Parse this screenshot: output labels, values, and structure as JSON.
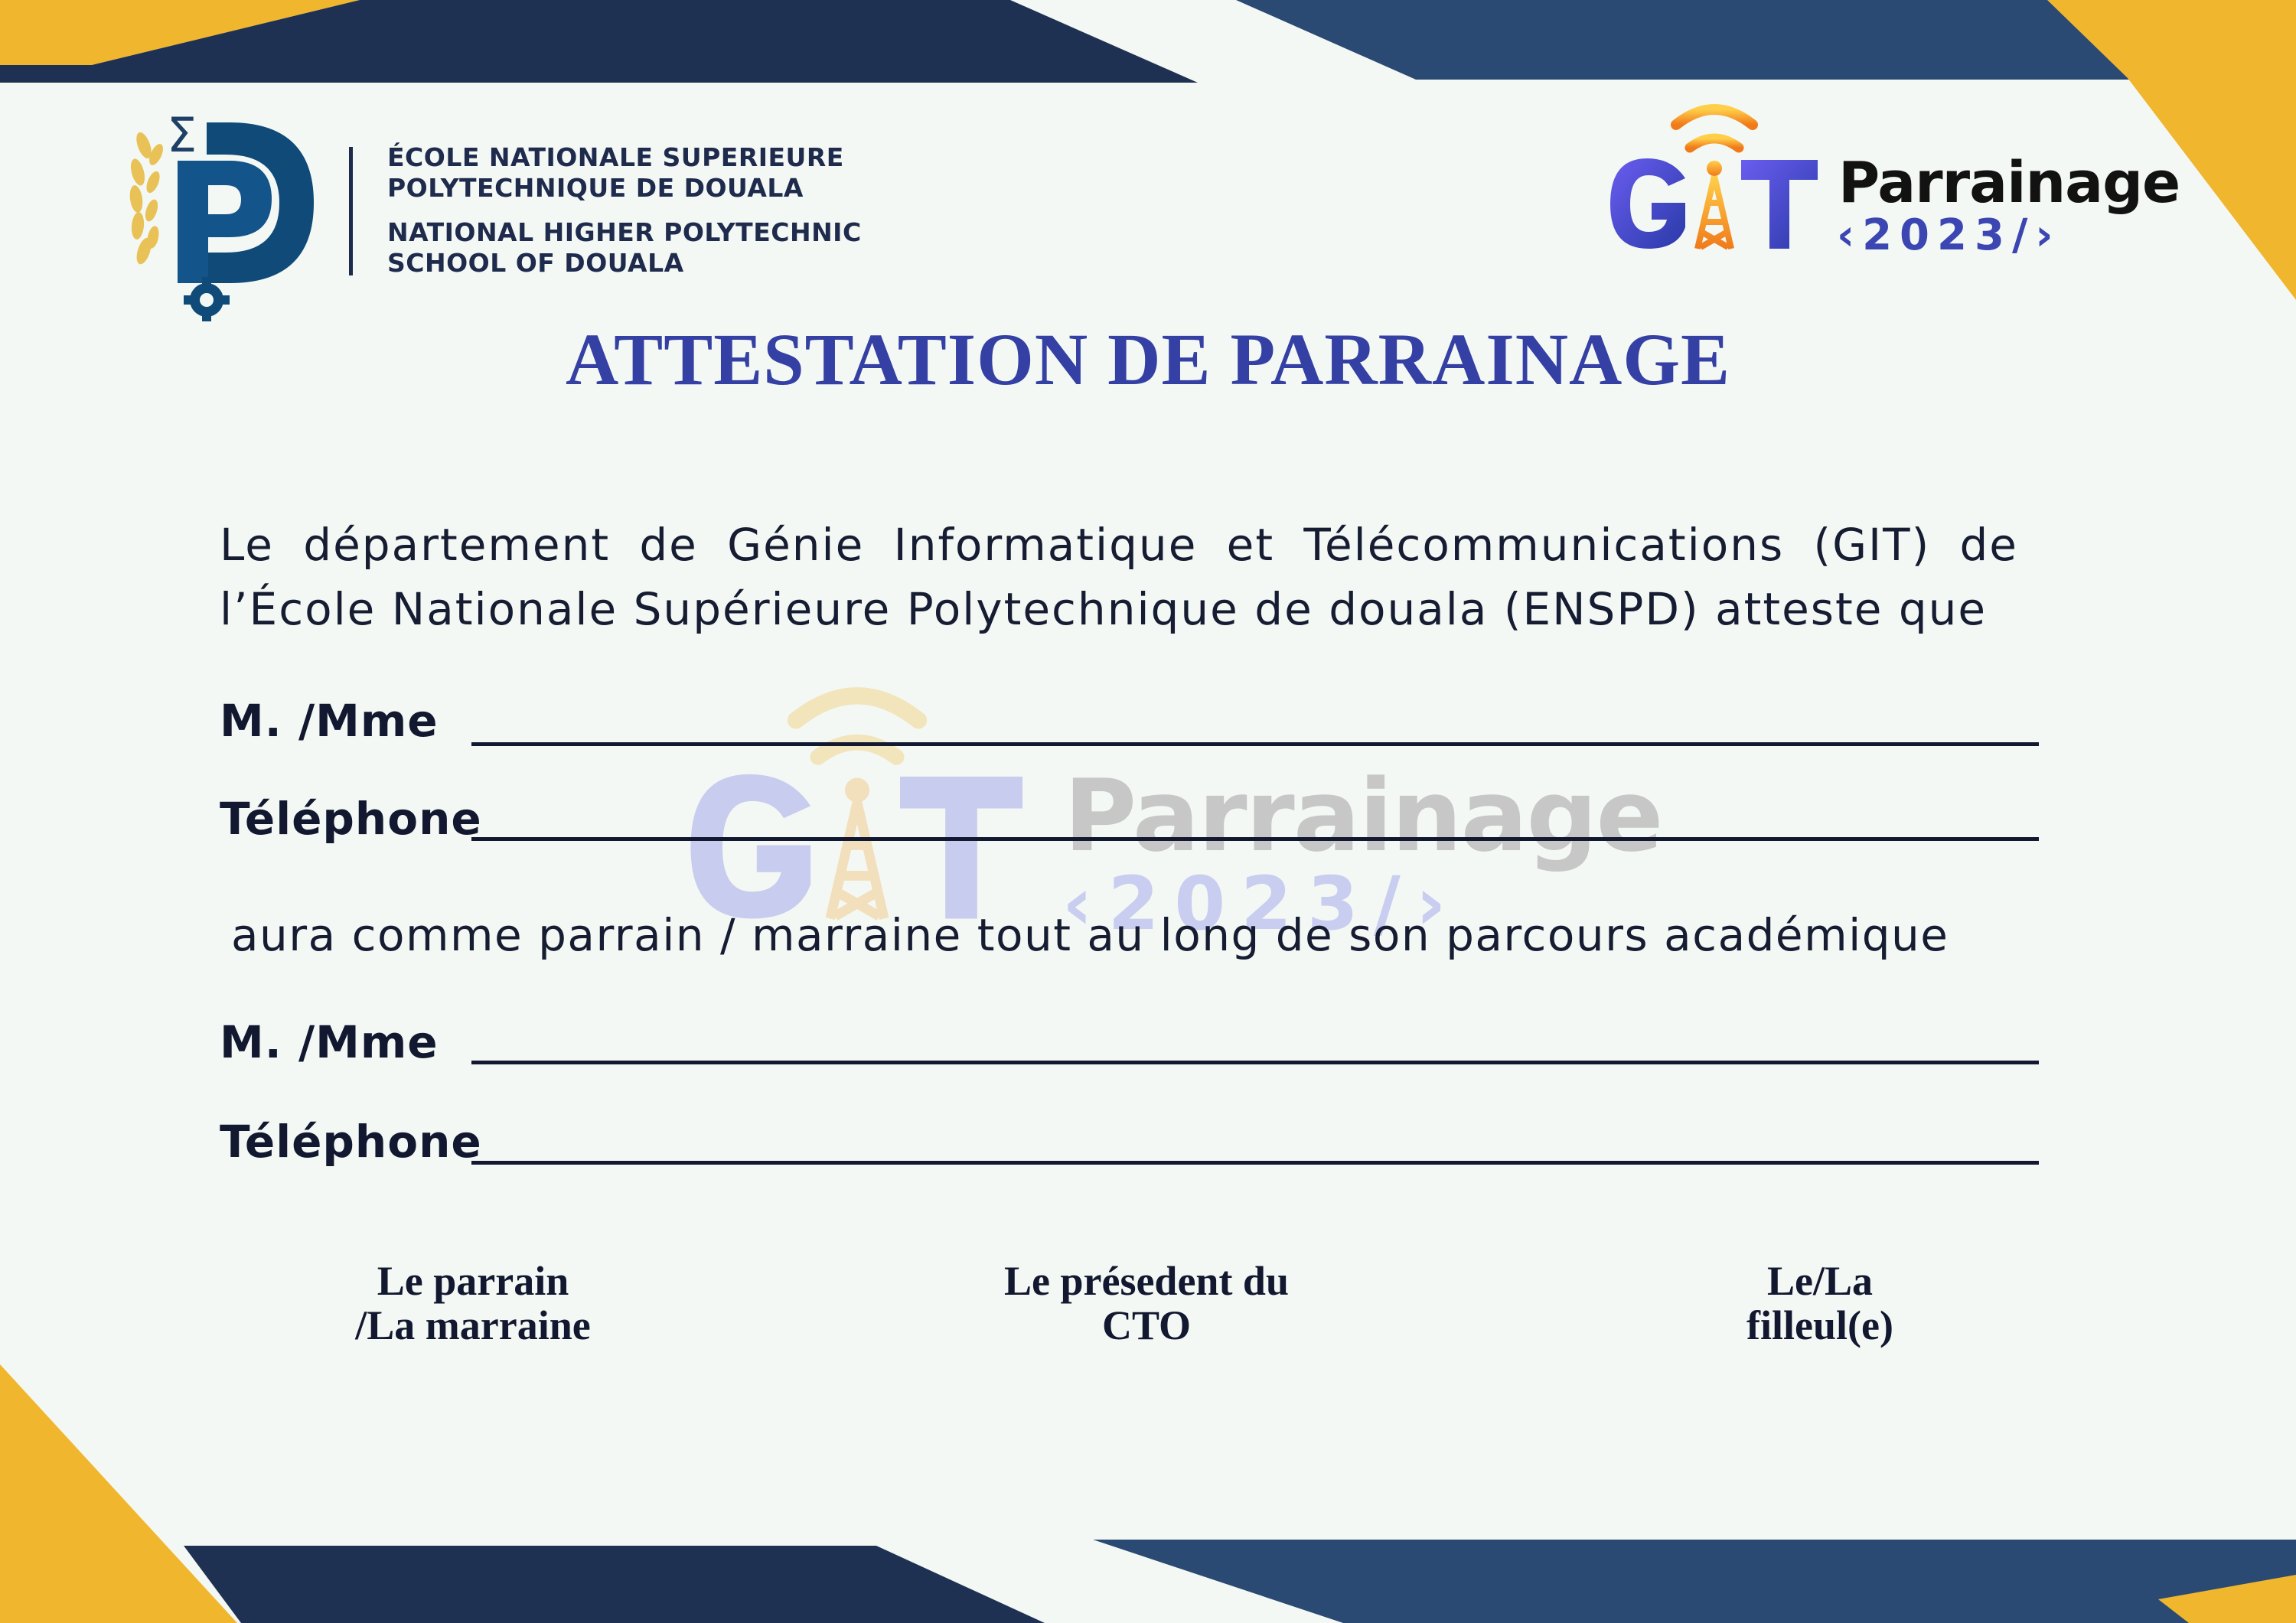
{
  "header": {
    "school_fr_line1": "ÉCOLE NATIONALE SUPERIEURE",
    "school_fr_line2": "POLYTECHNIQUE DE DOUALA",
    "school_en_line1": "NATIONAL HIGHER POLYTECHNIC",
    "school_en_line2": "SCHOOL OF DOUALA",
    "school_logo_icon": "enspd-logo-icon",
    "event_logo": {
      "letters": "GIT",
      "word": "Parrainage",
      "year": "‹2023/›",
      "icon": "radio-tower-icon"
    }
  },
  "title": "ATTESTATION DE PARRAINAGE",
  "intro": {
    "line1": "Le département de Génie Informatique et Télécommunications (GIT) de",
    "line2": "l’École Nationale Supérieure Polytechnique de douala (ENSPD) atteste que"
  },
  "filleul": {
    "name_label": "M. /Mme",
    "phone_label": "Téléphone"
  },
  "middle_text": "aura comme parrain / marraine tout au long de son parcours académique",
  "parrain": {
    "name_label": "M. /Mme",
    "phone_label": "Téléphone"
  },
  "signatures": [
    {
      "line1": "Le parrain",
      "line2": "/La marraine"
    },
    {
      "line1": "Le présedent du",
      "line2": "CTO"
    },
    {
      "line1": "Le/La",
      "line2": "filleul(e)"
    }
  ],
  "watermark": {
    "letters": "GIT",
    "word": "Parrainage",
    "year": "‹2023/›"
  },
  "colors": {
    "navy": "#1f3153",
    "blue": "#2a4a73",
    "yellow": "#f0b62e",
    "title": "#3440a3",
    "logo_blue": "#3b46b3",
    "logo_orange": "#f2a21a"
  }
}
